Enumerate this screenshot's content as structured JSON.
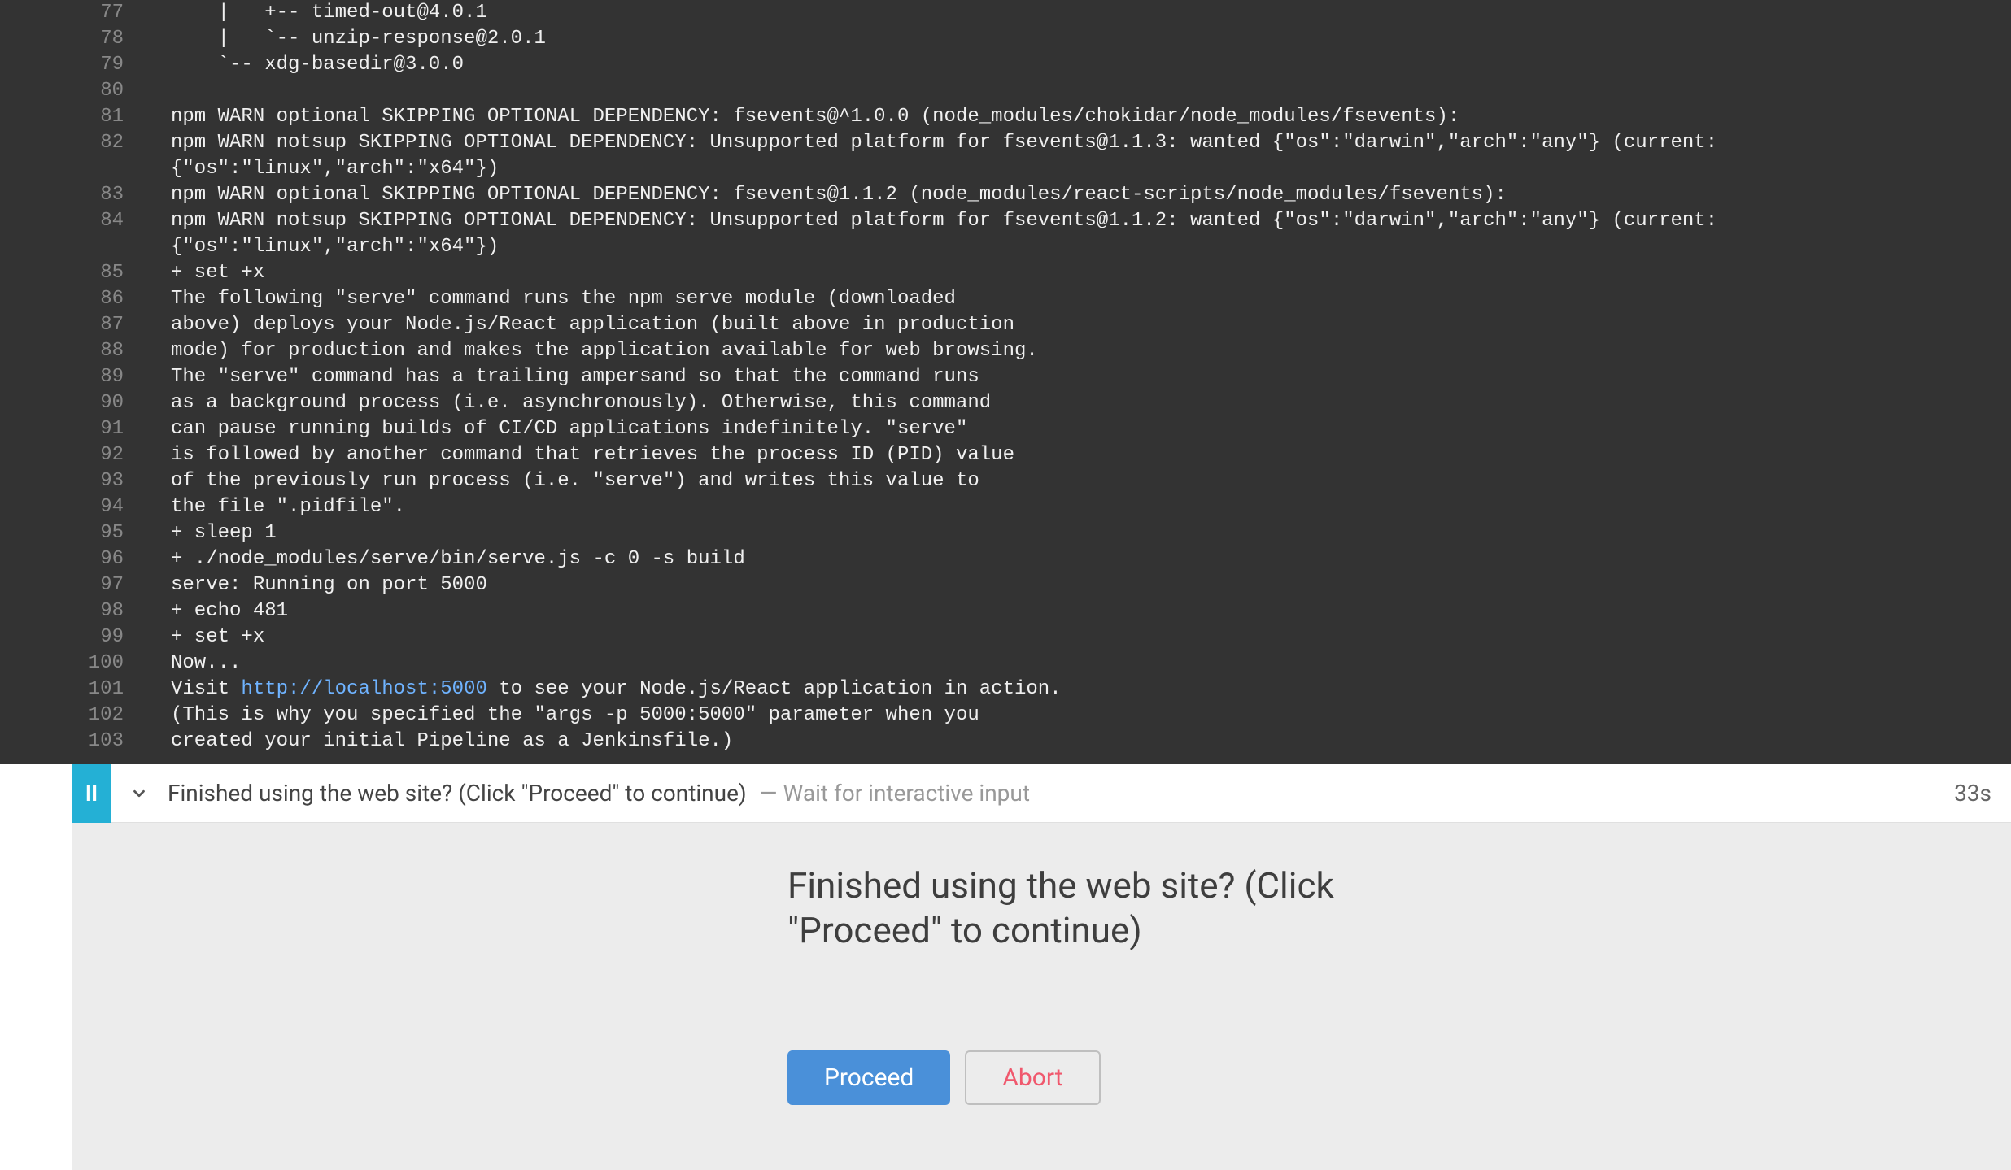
{
  "console": {
    "link_url": "http://localhost:5000",
    "lines": [
      {
        "n": 77,
        "text": "    |   +-- timed-out@4.0.1"
      },
      {
        "n": 78,
        "text": "    |   `-- unzip-response@2.0.1"
      },
      {
        "n": 79,
        "text": "    `-- xdg-basedir@3.0.0"
      },
      {
        "n": 80,
        "text": ""
      },
      {
        "n": 81,
        "text": "npm WARN optional SKIPPING OPTIONAL DEPENDENCY: fsevents@^1.0.0 (node_modules/chokidar/node_modules/fsevents):"
      },
      {
        "n": 82,
        "text": "npm WARN notsup SKIPPING OPTIONAL DEPENDENCY: Unsupported platform for fsevents@1.1.3: wanted {\"os\":\"darwin\",\"arch\":\"any\"} (current: {\"os\":\"linux\",\"arch\":\"x64\"})"
      },
      {
        "n": 83,
        "text": "npm WARN optional SKIPPING OPTIONAL DEPENDENCY: fsevents@1.1.2 (node_modules/react-scripts/node_modules/fsevents):"
      },
      {
        "n": 84,
        "text": "npm WARN notsup SKIPPING OPTIONAL DEPENDENCY: Unsupported platform for fsevents@1.1.2: wanted {\"os\":\"darwin\",\"arch\":\"any\"} (current: {\"os\":\"linux\",\"arch\":\"x64\"})"
      },
      {
        "n": 85,
        "text": "+ set +x"
      },
      {
        "n": 86,
        "text": "The following \"serve\" command runs the npm serve module (downloaded"
      },
      {
        "n": 87,
        "text": "above) deploys your Node.js/React application (built above in production"
      },
      {
        "n": 88,
        "text": "mode) for production and makes the application available for web browsing."
      },
      {
        "n": 89,
        "text": "The \"serve\" command has a trailing ampersand so that the command runs"
      },
      {
        "n": 90,
        "text": "as a background process (i.e. asynchronously). Otherwise, this command"
      },
      {
        "n": 91,
        "text": "can pause running builds of CI/CD applications indefinitely. \"serve\""
      },
      {
        "n": 92,
        "text": "is followed by another command that retrieves the process ID (PID) value"
      },
      {
        "n": 93,
        "text": "of the previously run process (i.e. \"serve\") and writes this value to"
      },
      {
        "n": 94,
        "text": "the file \".pidfile\"."
      },
      {
        "n": 95,
        "text": "+ sleep 1"
      },
      {
        "n": 96,
        "text": "+ ./node_modules/serve/bin/serve.js -c 0 -s build"
      },
      {
        "n": 97,
        "text": "serve: Running on port 5000"
      },
      {
        "n": 98,
        "text": "+ echo 481"
      },
      {
        "n": 99,
        "text": "+ set +x"
      },
      {
        "n": 100,
        "text": "Now..."
      },
      {
        "n": 101,
        "pre": "Visit ",
        "link": "http://localhost:5000",
        "post": " to see your Node.js/React application in action."
      },
      {
        "n": 102,
        "text": "(This is why you specified the \"args -p 5000:5000\" parameter when you"
      },
      {
        "n": 103,
        "text": "created your initial Pipeline as a Jenkinsfile.)"
      }
    ]
  },
  "stage": {
    "pause_glyph": "II",
    "title": "Finished using the web site? (Click \"Proceed\" to continue)",
    "subtitle": "— Wait for interactive input",
    "time": "33s"
  },
  "prompt": {
    "heading": "Finished using the web site? (Click \"Proceed\" to continue)",
    "proceed": "Proceed",
    "abort": "Abort"
  }
}
